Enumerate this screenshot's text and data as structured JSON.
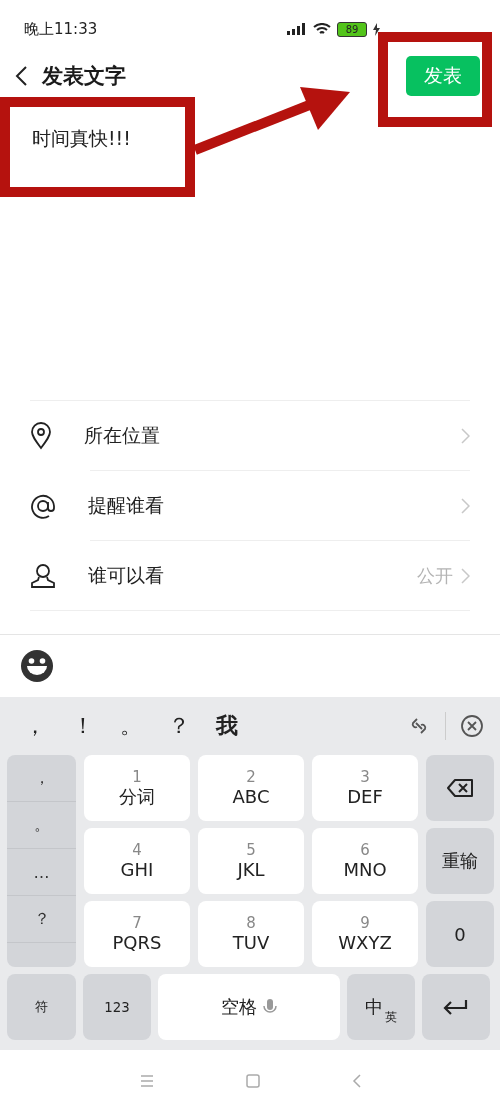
{
  "status_bar": {
    "time": "晚上11:33",
    "battery": "89"
  },
  "header": {
    "title": "发表文字",
    "post_button": "发表"
  },
  "post_text": "时间真快!!!",
  "options": [
    {
      "kind": "location",
      "label": "所在位置"
    },
    {
      "kind": "mention",
      "label": "提醒谁看"
    },
    {
      "kind": "person",
      "label": "谁可以看",
      "value": "公开"
    }
  ],
  "keyboard": {
    "candidates": [
      "，",
      "！",
      "。",
      "？",
      "我"
    ],
    "symbols": [
      "，",
      "。",
      "…",
      "？"
    ],
    "keys": [
      {
        "number": "1",
        "letters": "分词"
      },
      {
        "number": "2",
        "letters": "ABC"
      },
      {
        "number": "3",
        "letters": "DEF"
      },
      {
        "number": "4",
        "letters": "GHI"
      },
      {
        "number": "5",
        "letters": "JKL"
      },
      {
        "number": "6",
        "letters": "MNO"
      },
      {
        "number": "7",
        "letters": "PQRS"
      },
      {
        "number": "8",
        "letters": "TUV"
      },
      {
        "number": "9",
        "letters": "WXYZ"
      }
    ],
    "side_keys": [
      {
        "kind": "backspace"
      },
      {
        "kind": "text",
        "label": "重输"
      },
      {
        "kind": "text",
        "label": "0"
      }
    ],
    "bottom_keys": [
      {
        "kind": "symbols",
        "label": "符"
      },
      {
        "kind": "numbers",
        "label": "123"
      },
      {
        "kind": "space",
        "label": "空格"
      },
      {
        "kind": "language",
        "label": "中",
        "sub": "英"
      },
      {
        "kind": "enter"
      }
    ]
  }
}
